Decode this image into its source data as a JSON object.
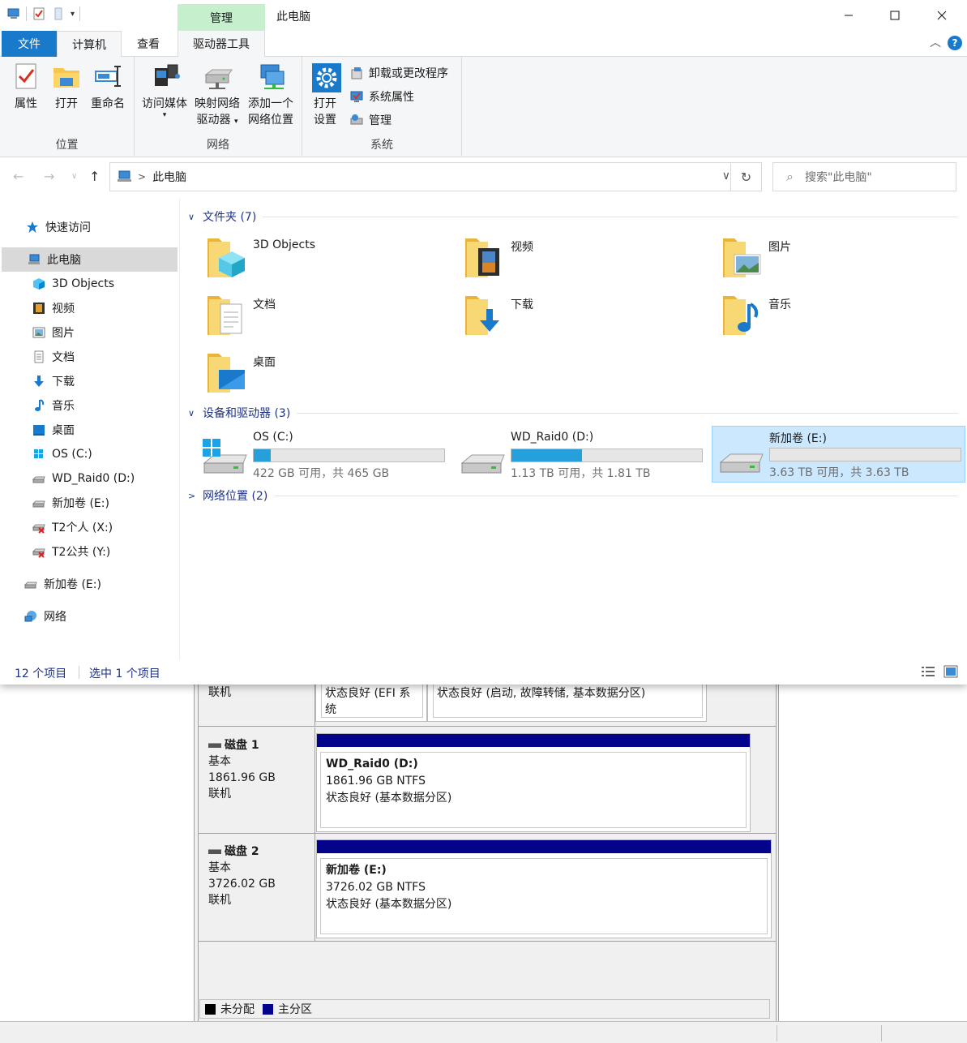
{
  "explorer": {
    "title": "此电脑",
    "context_tab": "管理",
    "tabs": [
      "文件",
      "计算机",
      "查看",
      "驱动器工具"
    ],
    "ribbon": {
      "location_group": {
        "label": "位置",
        "properties": "属性",
        "open": "打开",
        "rename": "重命名"
      },
      "network_group": {
        "label": "网络",
        "access_media": "访问媒体",
        "map_drive_line1": "映射网络",
        "map_drive_line2": "驱动器",
        "add_location_line1": "添加一个",
        "add_location_line2": "网络位置"
      },
      "system_group": {
        "label": "系统",
        "open_settings_line1": "打开",
        "open_settings_line2": "设置",
        "uninstall": "卸载或更改程序",
        "system_properties": "系统属性",
        "manage": "管理"
      }
    },
    "address": {
      "path": "此电脑",
      "search_placeholder": "搜索\"此电脑\""
    },
    "nav": {
      "quick_access": "快速访问",
      "this_pc": "此电脑",
      "items": [
        "3D Objects",
        "视频",
        "图片",
        "文档",
        "下载",
        "音乐",
        "桌面",
        "OS (C:)",
        "WD_Raid0 (D:)",
        "新加卷 (E:)",
        "T2个人 (X:)",
        "T2公共 (Y:)"
      ],
      "extra_drive": "新加卷 (E:)",
      "network": "网络"
    },
    "sections": {
      "folders": "文件夹 (7)",
      "devices": "设备和驱动器 (3)",
      "network_locations": "网络位置 (2)"
    },
    "folders": [
      "3D Objects",
      "视频",
      "图片",
      "文档",
      "下载",
      "音乐",
      "桌面"
    ],
    "drives": [
      {
        "name": "OS (C:)",
        "free_text": "422 GB 可用，共 465 GB",
        "used_fraction": 0.09
      },
      {
        "name": "WD_Raid0 (D:)",
        "free_text": "1.13 TB 可用，共 1.81 TB",
        "used_fraction": 0.37
      },
      {
        "name": "新加卷 (E:)",
        "free_text": "3.63 TB 可用，共 3.63 TB",
        "used_fraction": 0.0
      }
    ],
    "status": {
      "item_count": "12 个项目",
      "selected": "选中 1 个项目"
    }
  },
  "disk_management": {
    "partial_row": {
      "status_label": "联机",
      "efi_status": "状态良好 (EFI 系统",
      "main_status": "状态良好 (启动, 故障转储, 基本数据分区)"
    },
    "disks": [
      {
        "name": "磁盘 1",
        "type": "基本",
        "size": "1861.96 GB",
        "state": "联机",
        "partition_name": "WD_Raid0  (D:)",
        "partition_size": "1861.96 GB NTFS",
        "partition_status": "状态良好 (基本数据分区)"
      },
      {
        "name": "磁盘 2",
        "type": "基本",
        "size": "3726.02 GB",
        "state": "联机",
        "partition_name": "新加卷  (E:)",
        "partition_size": "3726.02 GB NTFS",
        "partition_status": "状态良好 (基本数据分区)"
      }
    ],
    "legend": {
      "unallocated": "未分配",
      "primary": "主分区",
      "unallocated_color": "#000000",
      "primary_color": "#03038c"
    }
  },
  "colors": {
    "accent": "#1979ca",
    "context_tab": "#c6efce",
    "selection": "#cce8ff",
    "link_blue": "#1e3287",
    "usage_bar": "#26a0da"
  }
}
